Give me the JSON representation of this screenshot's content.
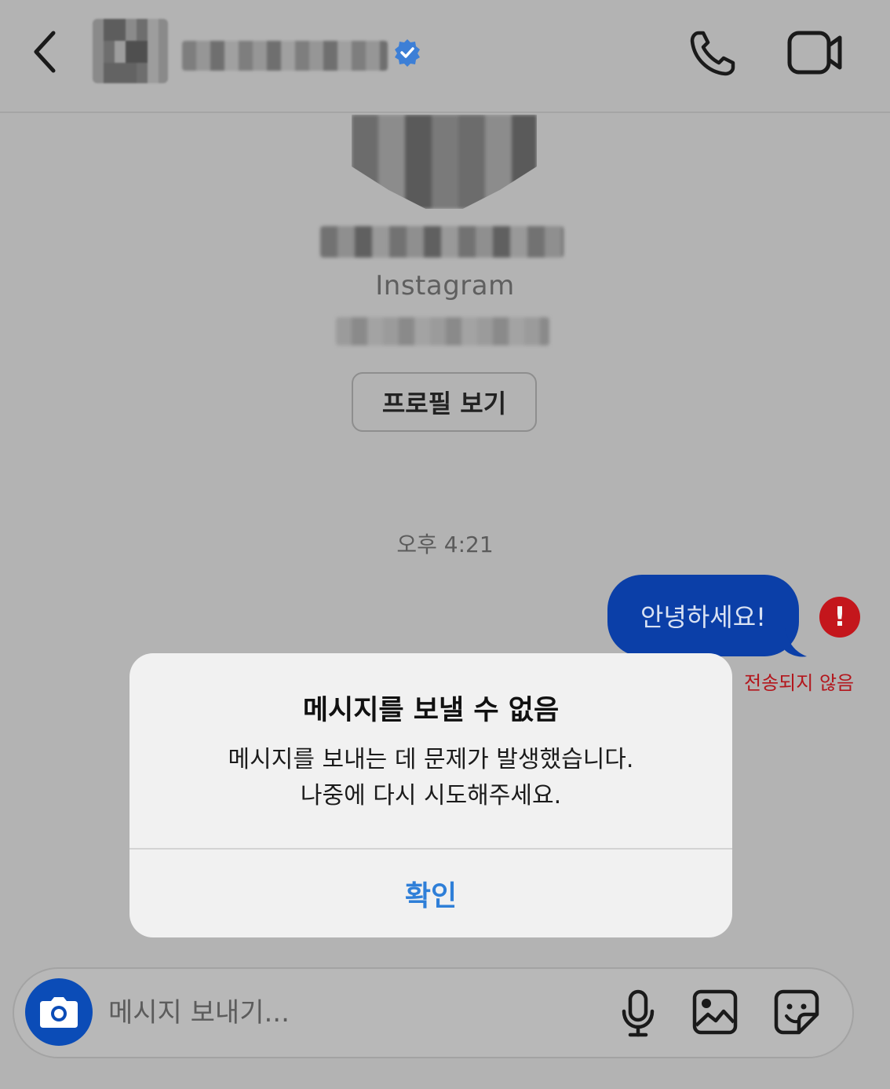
{
  "header": {
    "back_icon": "chevron-left-icon",
    "verified_icon": "verified-badge-icon",
    "call_icon": "phone-icon",
    "video_icon": "video-camera-icon"
  },
  "profile": {
    "platform_label": "Instagram",
    "view_profile_label": "프로필 보기"
  },
  "conversation": {
    "timestamp": "오후 4:21",
    "messages": [
      {
        "text": "안녕하세요!",
        "status": "전송되지 않음",
        "error_icon": "!"
      }
    ]
  },
  "dialog": {
    "title": "메시지를 보낼 수 없음",
    "message_line1": "메시지를 보내는 데 문제가 발생했습니다.",
    "message_line2": "나중에 다시 시도해주세요.",
    "confirm_label": "확인"
  },
  "composer": {
    "placeholder": "메시지 보내기...",
    "camera_icon": "camera-icon",
    "mic_icon": "microphone-icon",
    "gallery_icon": "image-gallery-icon",
    "sticker_icon": "sticker-icon"
  },
  "colors": {
    "overlay_bg": "#b3b3b3",
    "bubble_blue": "#0b3fa8",
    "error_red": "#c4161c",
    "link_blue": "#2f7fd8",
    "verified_blue": "#3d7fd6"
  }
}
